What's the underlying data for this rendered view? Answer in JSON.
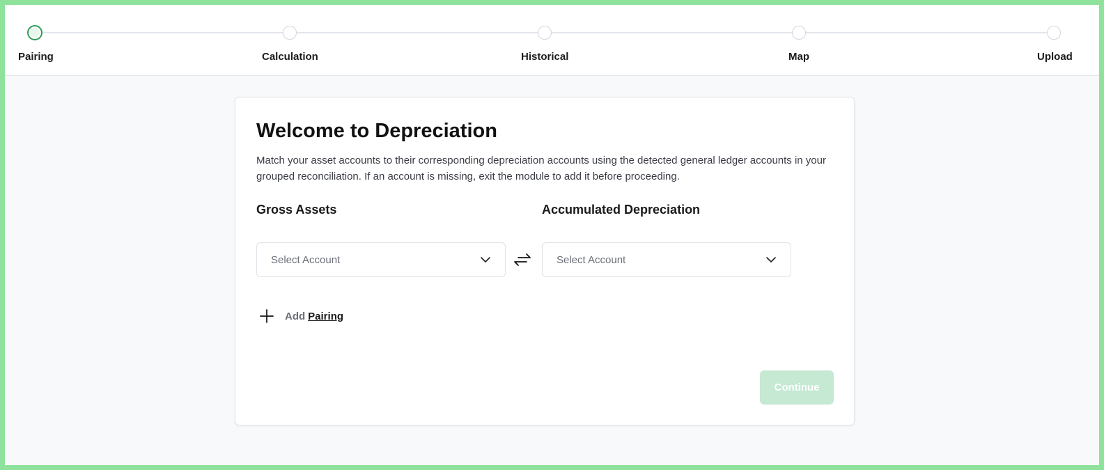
{
  "stepper": {
    "steps": [
      {
        "label": "Pairing",
        "active": true
      },
      {
        "label": "Calculation",
        "active": false
      },
      {
        "label": "Historical",
        "active": false
      },
      {
        "label": "Map",
        "active": false
      },
      {
        "label": "Upload",
        "active": false
      }
    ]
  },
  "card": {
    "title": "Welcome to Depreciation",
    "description": "Match your asset accounts to their corresponding depreciation accounts using the detected general ledger accounts in your grouped reconciliation. If an account is missing, exit the module to add it before proceeding.",
    "gross_assets_label": "Gross Assets",
    "accumulated_label": "Accumulated Depreciation",
    "gross_select_placeholder": "Select Account",
    "accumulated_select_placeholder": "Select Account",
    "add_text": "Add",
    "add_link": "Pairing",
    "continue_label": "Continue"
  },
  "colors": {
    "active_step": "#2e9e57",
    "continue_disabled_bg": "#c5e9d3",
    "frame_border": "#8fe29c"
  },
  "icons": {
    "swap": "swap-arrows-icon",
    "chevron": "chevron-down-icon",
    "plus": "plus-icon"
  }
}
